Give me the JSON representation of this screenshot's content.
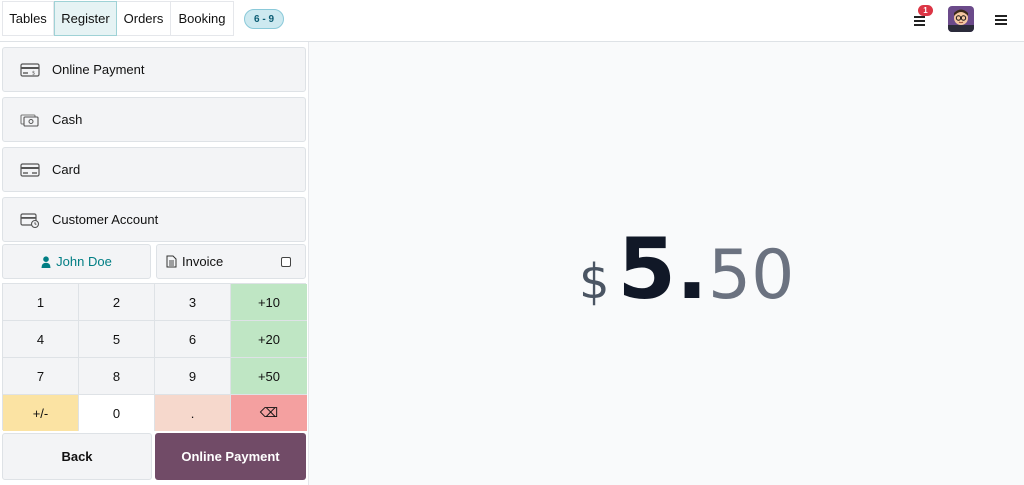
{
  "header": {
    "tabs": [
      {
        "label": "Tables",
        "active": false
      },
      {
        "label": "Register",
        "active": true
      },
      {
        "label": "Orders",
        "active": false
      },
      {
        "label": "Booking",
        "active": false
      }
    ],
    "table_range_badge": "6 - 9",
    "notification_count": "1",
    "icons": {
      "orders": "orders-list-icon",
      "menu": "hamburger-menu-icon",
      "avatar": "user-avatar"
    }
  },
  "payment_methods": [
    {
      "label": "Online Payment",
      "icon": "online-payment-icon"
    },
    {
      "label": "Cash",
      "icon": "cash-icon"
    },
    {
      "label": "Card",
      "icon": "card-icon"
    },
    {
      "label": "Customer Account",
      "icon": "customer-account-icon"
    }
  ],
  "customer": {
    "name": "John Doe",
    "icon": "user-icon"
  },
  "invoice": {
    "label": "Invoice",
    "checked": false
  },
  "numpad": {
    "keys": [
      "1",
      "2",
      "3",
      "+10",
      "4",
      "5",
      "6",
      "+20",
      "7",
      "8",
      "9",
      "+50",
      "+/-",
      "0",
      ".",
      "⌫"
    ]
  },
  "actions": {
    "back": "Back",
    "validate": "Online Payment"
  },
  "total": {
    "currency": "$",
    "integer": "5",
    "separator": ".",
    "decimals": "50"
  },
  "colors": {
    "accent": "#714b67",
    "teal": "#017e84",
    "quick_add": "#bfe6c4",
    "sign": "#fbe3a3",
    "backspace": "#f4a0a0"
  }
}
